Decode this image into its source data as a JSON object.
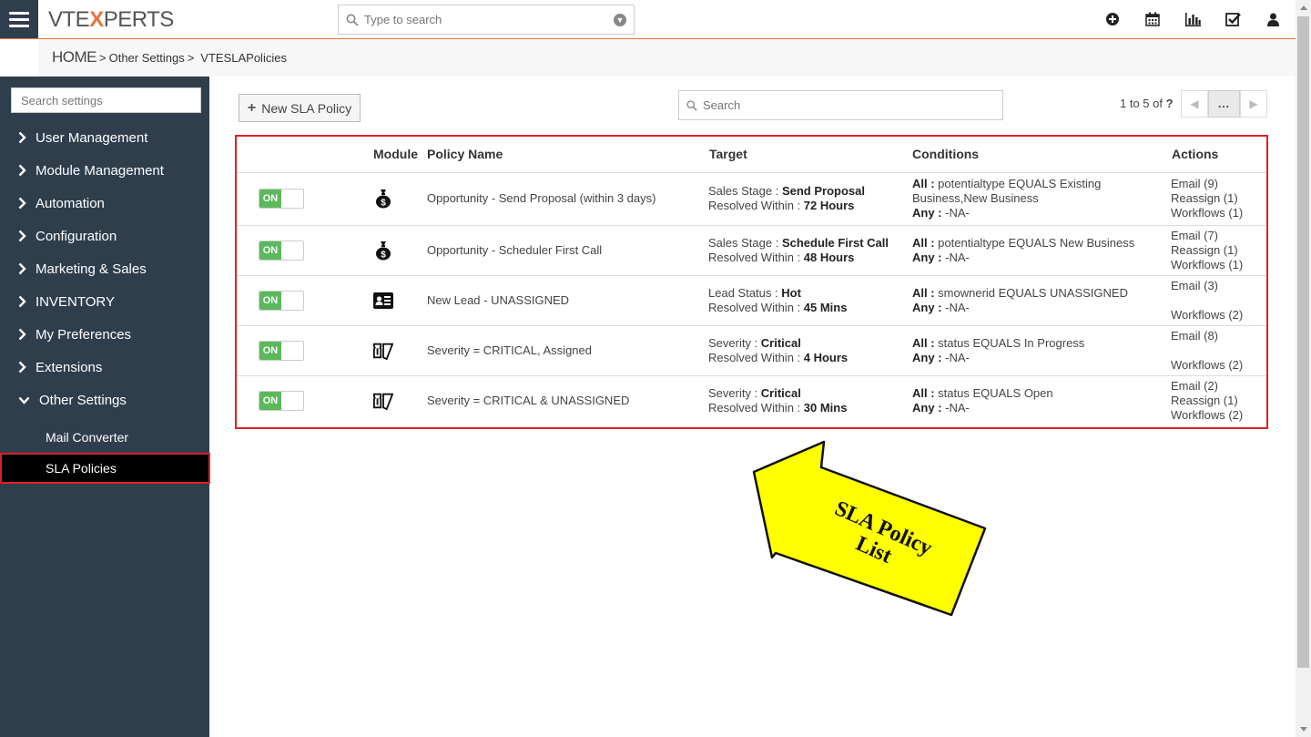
{
  "header": {
    "logo_left": "VTE",
    "logo_x": "X",
    "logo_right": "PERTS",
    "search_placeholder": "Type to search",
    "icons": [
      "plus-circle-icon",
      "calendar-icon",
      "chart-icon",
      "checkbox-icon",
      "user-icon"
    ]
  },
  "breadcrumb": {
    "home": "HOME",
    "sep1": ">",
    "level1": "Other Settings",
    "sep2": ">",
    "level2": "VTESLAPolicies"
  },
  "sidebar": {
    "search_placeholder": "Search settings",
    "items": [
      {
        "label": "User Management"
      },
      {
        "label": "Module Management"
      },
      {
        "label": "Automation"
      },
      {
        "label": "Configuration"
      },
      {
        "label": "Marketing & Sales"
      },
      {
        "label": "INVENTORY"
      },
      {
        "label": "My Preferences"
      },
      {
        "label": "Extensions"
      },
      {
        "label": "Other Settings"
      }
    ],
    "subitems": [
      {
        "label": "Mail Converter"
      },
      {
        "label": "SLA Policies"
      }
    ]
  },
  "toolbar": {
    "new_button": "New SLA Policy",
    "search_placeholder": "Search",
    "pager_text": "1 to 5  of",
    "pager_total": "?",
    "pager_more": "..."
  },
  "table": {
    "headers": {
      "module": "Module",
      "policy_name": "Policy Name",
      "target": "Target",
      "conditions": "Conditions",
      "actions": "Actions"
    },
    "rows": [
      {
        "status": "ON",
        "module_icon": "money-bag-icon",
        "name": "Opportunity - Send Proposal (within 3 days)",
        "target_label": "Sales Stage : ",
        "target_value": "Send Proposal",
        "resolved_label": "Resolved Within : ",
        "resolved_value": "72 Hours",
        "all_label": "All : ",
        "all_value": "potentialtype EQUALS Existing Business,New Business",
        "any_label": "Any : ",
        "any_value": "-NA-",
        "action1": "Email (9)",
        "action2": "Reassign (1)",
        "action3": "Workflows (1)"
      },
      {
        "status": "ON",
        "module_icon": "money-bag-icon",
        "name": "Opportunity - Scheduler First Call",
        "target_label": "Sales Stage : ",
        "target_value": "Schedule First Call",
        "resolved_label": "Resolved Within : ",
        "resolved_value": "48 Hours",
        "all_label": "All : ",
        "all_value": "potentialtype EQUALS New Business",
        "any_label": "Any : ",
        "any_value": "-NA-",
        "action1": "Email (7)",
        "action2": "Reassign (1)",
        "action3": "Workflows (1)"
      },
      {
        "status": "ON",
        "module_icon": "id-card-icon",
        "name": "New Lead - UNASSIGNED",
        "target_label": "Lead Status : ",
        "target_value": "Hot",
        "resolved_label": "Resolved Within : ",
        "resolved_value": "45 Mins",
        "all_label": "All : ",
        "all_value": "smownerid EQUALS UNASSIGNED",
        "any_label": "Any : ",
        "any_value": "-NA-",
        "action1": "Email (3)",
        "action2": "",
        "action3": "Workflows (2)"
      },
      {
        "status": "ON",
        "module_icon": "ticket-icon",
        "name": "Severity = CRITICAL, Assigned",
        "target_label": "Severity : ",
        "target_value": "Critical",
        "resolved_label": "Resolved Within : ",
        "resolved_value": "4 Hours",
        "all_label": "All : ",
        "all_value": "status EQUALS In Progress",
        "any_label": "Any : ",
        "any_value": "-NA-",
        "action1": "Email (8)",
        "action2": "",
        "action3": "Workflows (2)"
      },
      {
        "status": "ON",
        "module_icon": "ticket-icon",
        "name": "Severity = CRITICAL & UNASSIGNED",
        "target_label": "Severity : ",
        "target_value": "Critical",
        "resolved_label": "Resolved Within : ",
        "resolved_value": "30 Mins",
        "all_label": "All : ",
        "all_value": "status EQUALS Open",
        "any_label": "Any : ",
        "any_value": "-NA-",
        "action1": "Email (2)",
        "action2": "Reassign (1)",
        "action3": "Workflows (2)"
      }
    ]
  },
  "callout": {
    "line1": "SLA Policy",
    "line2": "List"
  },
  "colors": {
    "sidebar_bg": "#2f3e4d",
    "accent": "#e8743b",
    "highlight_border": "#e21f26",
    "toggle_on": "#5cb85c",
    "callout_fill": "#ffff00"
  }
}
